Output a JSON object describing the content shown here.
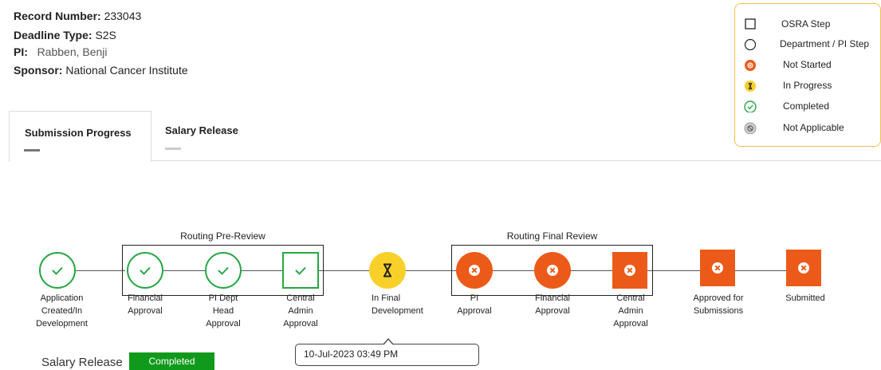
{
  "record": {
    "record_number_label": "Record Number:",
    "record_number_value": "233043",
    "deadline_label": "Deadline Type:",
    "deadline_value": "S2S",
    "pi_label": "PI:",
    "pi_value": "Rabben, Benji",
    "sponsor_label": "Sponsor:",
    "sponsor_value": "National Cancer Institute"
  },
  "legend": [
    {
      "label": "OSRA Step",
      "icon": "square-outline-icon"
    },
    {
      "label": "Department / PI Step",
      "icon": "circle-outline-icon"
    },
    {
      "label": "Not Started",
      "icon": "x-circle-orange-icon"
    },
    {
      "label": "In Progress",
      "icon": "hourglass-yellow-icon"
    },
    {
      "label": "Completed",
      "icon": "check-circle-green-icon"
    },
    {
      "label": "Not Applicable",
      "icon": "na-circle-gray-icon"
    }
  ],
  "tabs": [
    {
      "label": "Submission Progress",
      "active": true
    },
    {
      "label": "Salary Release",
      "active": false
    }
  ],
  "groups": {
    "pre_review": "Routing Pre-Review",
    "final_review": "Routing Final Review"
  },
  "steps": [
    {
      "label": "Application Created/In Development",
      "status": "completed",
      "shape": "circle"
    },
    {
      "label": "Financial Approval",
      "status": "completed",
      "shape": "circle"
    },
    {
      "label": "PI Dept Head Approval",
      "status": "completed",
      "shape": "circle"
    },
    {
      "label": "Central Admin Approval",
      "status": "completed",
      "shape": "square"
    },
    {
      "label": "In Final Development",
      "status": "in-progress",
      "shape": "circle"
    },
    {
      "label": "PI Approval",
      "status": "not-started",
      "shape": "circle"
    },
    {
      "label": "Financial Approval",
      "status": "not-started",
      "shape": "circle"
    },
    {
      "label": "Central Admin Approval",
      "status": "not-started",
      "shape": "square"
    },
    {
      "label": "Approved for Submissions",
      "status": "not-started",
      "shape": "square"
    },
    {
      "label": "Submitted",
      "status": "not-started",
      "shape": "square"
    }
  ],
  "salary_release": {
    "label": "Salary Release",
    "status": "Completed"
  },
  "tooltip": {
    "text": "10-Jul-2023 03:49 PM"
  },
  "colors": {
    "completed": "#28a745",
    "not_started": "#ec5a19",
    "in_progress": "#f8d029",
    "not_applicable": "#bdbdbd",
    "legend_border": "#f0c24b",
    "badge": "#109a1c"
  }
}
